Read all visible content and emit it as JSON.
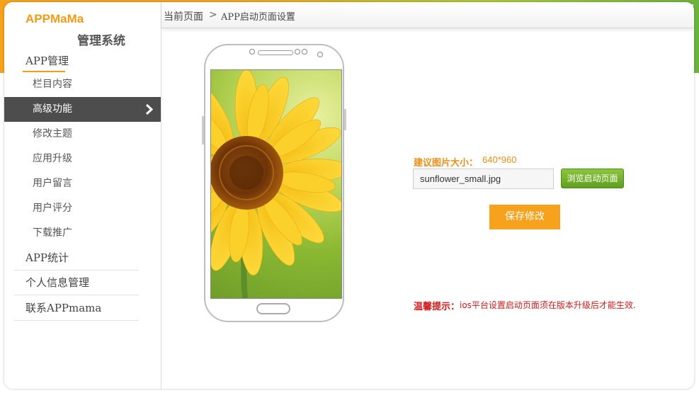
{
  "brand": {
    "name_en": "APPMaMa",
    "name_cn": "管理系统"
  },
  "sidebar": {
    "section_title": "APP管理",
    "items": [
      {
        "label": "栏目内容"
      },
      {
        "label": "高级功能",
        "active": true
      },
      {
        "label": "修改主题"
      },
      {
        "label": "应用升级"
      },
      {
        "label": "用户留言"
      },
      {
        "label": "用户评分"
      },
      {
        "label": "下载推广"
      }
    ],
    "groups": [
      {
        "label": "APP统计"
      },
      {
        "label": "个人信息管理"
      },
      {
        "label": "联系APPmama"
      }
    ],
    "chevron_icon": "chevron-right-icon"
  },
  "breadcrumb": {
    "current_label": "当前页面",
    "separator": ">",
    "page": "APP启动页面设置"
  },
  "upload": {
    "size_label": "建议图片大小：",
    "size_value": "640*960",
    "file_value": "sunflower_small.jpg",
    "browse_label": "浏览启动页面",
    "save_label": "保存修改"
  },
  "tip": {
    "label": "温馨提示：",
    "text": "ios平台设置启动页面须在版本升级后才能生效."
  },
  "colors": {
    "accent_orange": "#f7a21c",
    "accent_green": "#6db33f",
    "active_menu_bg": "#4d4d4d",
    "tip_red": "#d01b1b"
  }
}
